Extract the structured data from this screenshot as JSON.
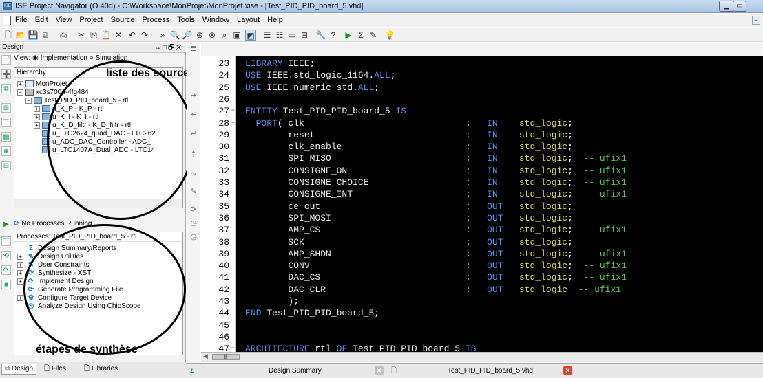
{
  "window": {
    "title": "ISE Project Navigator (O.40d) - C:\\Workspace\\MonProjet\\MonProjet.xise - [Test_PID_PID_board_5.vhd]"
  },
  "menu": [
    "File",
    "Edit",
    "View",
    "Project",
    "Source",
    "Process",
    "Tools",
    "Window",
    "Layout",
    "Help"
  ],
  "design_panel": {
    "title": "Design",
    "view_label": "View:",
    "view_option_1": "Implementation",
    "view_option_2": "Simulation",
    "hierarchy_header": "Hierarchy",
    "tree": [
      {
        "label": "MonProjet",
        "expander": "+",
        "level": 0,
        "icon": "project"
      },
      {
        "label": "xc3s700a-4fg484",
        "expander": "−",
        "level": 0,
        "icon": "chip"
      },
      {
        "label": "Test_PID_PID_board_5 - rtl",
        "expander": "−",
        "level": 1,
        "icon": "vhdl"
      },
      {
        "label": "u_K_P - K_P - rtl",
        "expander": "+",
        "level": 2,
        "icon": "vhdl"
      },
      {
        "label": "u_K_I - K_I - rtl",
        "expander": "+",
        "level": 2,
        "icon": "vhdl"
      },
      {
        "label": "u_K_D_filtr - K_D_filtr - rtl",
        "expander": "+",
        "level": 2,
        "icon": "vhdl"
      },
      {
        "label": "u_LTC2624_quad_DAC - LTC262",
        "expander": "",
        "level": 2,
        "icon": "vhdl"
      },
      {
        "label": "u_ADC_DAC_Controller - ADC_",
        "expander": "",
        "level": 2,
        "icon": "vhdl"
      },
      {
        "label": "u_LTC1407A_Dual_ADC - LTC14",
        "expander": "",
        "level": 2,
        "icon": "vhdl"
      }
    ],
    "process_status": "No Processes Running",
    "processes_header": "Processes: Test_PID_PID_board_5 - rtl",
    "processes": [
      {
        "label": "Design Summary/Reports",
        "icon": "Σ",
        "expander": ""
      },
      {
        "label": "Design Utilities",
        "icon": "✎",
        "expander": "+"
      },
      {
        "label": "User Constraints",
        "icon": "✎",
        "expander": "+"
      },
      {
        "label": "Synthesize - XST",
        "icon": "⟳",
        "expander": "+"
      },
      {
        "label": "Implement Design",
        "icon": "⟳",
        "expander": "+"
      },
      {
        "label": "Generate Programming File",
        "icon": "⟳",
        "expander": ""
      },
      {
        "label": "Configure Target Device",
        "icon": "⚙",
        "expander": "+"
      },
      {
        "label": "Analyze Design Using ChipScope",
        "icon": "◎",
        "expander": ""
      }
    ],
    "tabs": [
      "Design",
      "Files",
      "Libraries"
    ]
  },
  "annotations": {
    "sources": "liste des sources",
    "synthesis": "étapes de synthèse"
  },
  "editor": {
    "lines": [
      {
        "n": "23",
        "fold": "",
        "tokens": [
          [
            "kw",
            "LIBRARY "
          ],
          [
            "id",
            "IEEE"
          ],
          [
            "pl",
            ";"
          ]
        ]
      },
      {
        "n": "24",
        "fold": "",
        "tokens": [
          [
            "kw",
            "USE "
          ],
          [
            "id",
            "IEEE.std_logic_1164."
          ],
          [
            "kw",
            "ALL"
          ],
          [
            "pl",
            ";"
          ]
        ]
      },
      {
        "n": "25",
        "fold": "",
        "tokens": [
          [
            "kw",
            "USE "
          ],
          [
            "id",
            "IEEE.numeric_std."
          ],
          [
            "kw",
            "ALL"
          ],
          [
            "pl",
            ";"
          ]
        ]
      },
      {
        "n": "26",
        "fold": "",
        "tokens": []
      },
      {
        "n": "27",
        "fold": "−",
        "tokens": [
          [
            "kw",
            "ENTITY "
          ],
          [
            "id",
            "Test_PID_PID_board_5 "
          ],
          [
            "kw",
            "IS"
          ]
        ]
      },
      {
        "n": "28",
        "fold": "−",
        "tokens": [
          [
            "kw",
            "  PORT"
          ],
          [
            "pl",
            "( "
          ],
          [
            "id",
            "clk                              "
          ],
          [
            "pl",
            ":   "
          ],
          [
            "kw",
            "IN    "
          ],
          [
            "ty",
            "std_logic"
          ],
          [
            "pl",
            ";"
          ]
        ]
      },
      {
        "n": "29",
        "fold": "",
        "tokens": [
          [
            "id",
            "        reset                            "
          ],
          [
            "pl",
            ":   "
          ],
          [
            "kw",
            "IN    "
          ],
          [
            "ty",
            "std_logic"
          ],
          [
            "pl",
            ";"
          ]
        ]
      },
      {
        "n": "30",
        "fold": "",
        "tokens": [
          [
            "id",
            "        clk_enable                       "
          ],
          [
            "pl",
            ":   "
          ],
          [
            "kw",
            "IN    "
          ],
          [
            "ty",
            "std_logic"
          ],
          [
            "pl",
            ";"
          ]
        ]
      },
      {
        "n": "31",
        "fold": "",
        "tokens": [
          [
            "id",
            "        SPI_MISO                         "
          ],
          [
            "pl",
            ":   "
          ],
          [
            "kw",
            "IN    "
          ],
          [
            "ty",
            "std_logic"
          ],
          [
            "pl",
            ";  "
          ],
          [
            "cm",
            "-- ufix1"
          ]
        ]
      },
      {
        "n": "32",
        "fold": "",
        "tokens": [
          [
            "id",
            "        CONSIGNE_ON                      "
          ],
          [
            "pl",
            ":   "
          ],
          [
            "kw",
            "IN    "
          ],
          [
            "ty",
            "std_logic"
          ],
          [
            "pl",
            ";  "
          ],
          [
            "cm",
            "-- ufix1"
          ]
        ]
      },
      {
        "n": "33",
        "fold": "",
        "tokens": [
          [
            "id",
            "        CONSIGNE_CHOICE                  "
          ],
          [
            "pl",
            ":   "
          ],
          [
            "kw",
            "IN    "
          ],
          [
            "ty",
            "std_logic"
          ],
          [
            "pl",
            ";  "
          ],
          [
            "cm",
            "-- ufix1"
          ]
        ]
      },
      {
        "n": "34",
        "fold": "",
        "tokens": [
          [
            "id",
            "        CONSIGNE_INT                     "
          ],
          [
            "pl",
            ":   "
          ],
          [
            "kw",
            "IN    "
          ],
          [
            "ty",
            "std_logic"
          ],
          [
            "pl",
            ";  "
          ],
          [
            "cm",
            "-- ufix1"
          ]
        ]
      },
      {
        "n": "35",
        "fold": "",
        "tokens": [
          [
            "id",
            "        ce_out                           "
          ],
          [
            "pl",
            ":   "
          ],
          [
            "kw",
            "OUT   "
          ],
          [
            "ty",
            "std_logic"
          ],
          [
            "pl",
            ";"
          ]
        ]
      },
      {
        "n": "36",
        "fold": "",
        "tokens": [
          [
            "id",
            "        SPI_MOSI                         "
          ],
          [
            "pl",
            ":   "
          ],
          [
            "kw",
            "OUT   "
          ],
          [
            "ty",
            "std_logic"
          ],
          [
            "pl",
            ";"
          ]
        ]
      },
      {
        "n": "37",
        "fold": "",
        "tokens": [
          [
            "id",
            "        AMP_CS                           "
          ],
          [
            "pl",
            ":   "
          ],
          [
            "kw",
            "OUT   "
          ],
          [
            "ty",
            "std_logic"
          ],
          [
            "pl",
            ";  "
          ],
          [
            "cm",
            "-- ufix1"
          ]
        ]
      },
      {
        "n": "38",
        "fold": "",
        "tokens": [
          [
            "id",
            "        SCK                              "
          ],
          [
            "pl",
            ":   "
          ],
          [
            "kw",
            "OUT   "
          ],
          [
            "ty",
            "std_logic"
          ],
          [
            "pl",
            ";"
          ]
        ]
      },
      {
        "n": "39",
        "fold": "",
        "tokens": [
          [
            "id",
            "        AMP_SHDN                         "
          ],
          [
            "pl",
            ":   "
          ],
          [
            "kw",
            "OUT   "
          ],
          [
            "ty",
            "std_logic"
          ],
          [
            "pl",
            ";  "
          ],
          [
            "cm",
            "-- ufix1"
          ]
        ]
      },
      {
        "n": "40",
        "fold": "",
        "tokens": [
          [
            "id",
            "        CONV                             "
          ],
          [
            "pl",
            ":   "
          ],
          [
            "kw",
            "OUT   "
          ],
          [
            "ty",
            "std_logic"
          ],
          [
            "pl",
            ";  "
          ],
          [
            "cm",
            "-- ufix1"
          ]
        ]
      },
      {
        "n": "41",
        "fold": "",
        "tokens": [
          [
            "id",
            "        DAC_CS                           "
          ],
          [
            "pl",
            ":   "
          ],
          [
            "kw",
            "OUT   "
          ],
          [
            "ty",
            "std_logic"
          ],
          [
            "pl",
            ";  "
          ],
          [
            "cm",
            "-- ufix1"
          ]
        ]
      },
      {
        "n": "42",
        "fold": "",
        "tokens": [
          [
            "id",
            "        DAC_CLR                          "
          ],
          [
            "pl",
            ":   "
          ],
          [
            "kw",
            "OUT   "
          ],
          [
            "ty",
            "std_logic  "
          ],
          [
            "cm",
            "-- ufix1"
          ]
        ]
      },
      {
        "n": "43",
        "fold": "",
        "tokens": [
          [
            "id",
            "        "
          ],
          [
            "pl",
            ");"
          ]
        ]
      },
      {
        "n": "44",
        "fold": "",
        "tokens": [
          [
            "kw",
            "END "
          ],
          [
            "id",
            "Test_PID_PID_board_5"
          ],
          [
            "pl",
            ";"
          ]
        ]
      },
      {
        "n": "45",
        "fold": "",
        "tokens": []
      },
      {
        "n": "46",
        "fold": "",
        "tokens": []
      },
      {
        "n": "47",
        "fold": "−",
        "tokens": [
          [
            "kw",
            "ARCHITECTURE "
          ],
          [
            "id",
            "rtl "
          ],
          [
            "kw",
            "OF "
          ],
          [
            "id",
            "Test_PID_PID_board_5 "
          ],
          [
            "kw",
            "IS"
          ]
        ]
      }
    ]
  },
  "bottom_tabs": {
    "summary": "Design Summary",
    "file": "Test_PID_PID_board_5.vhd"
  }
}
